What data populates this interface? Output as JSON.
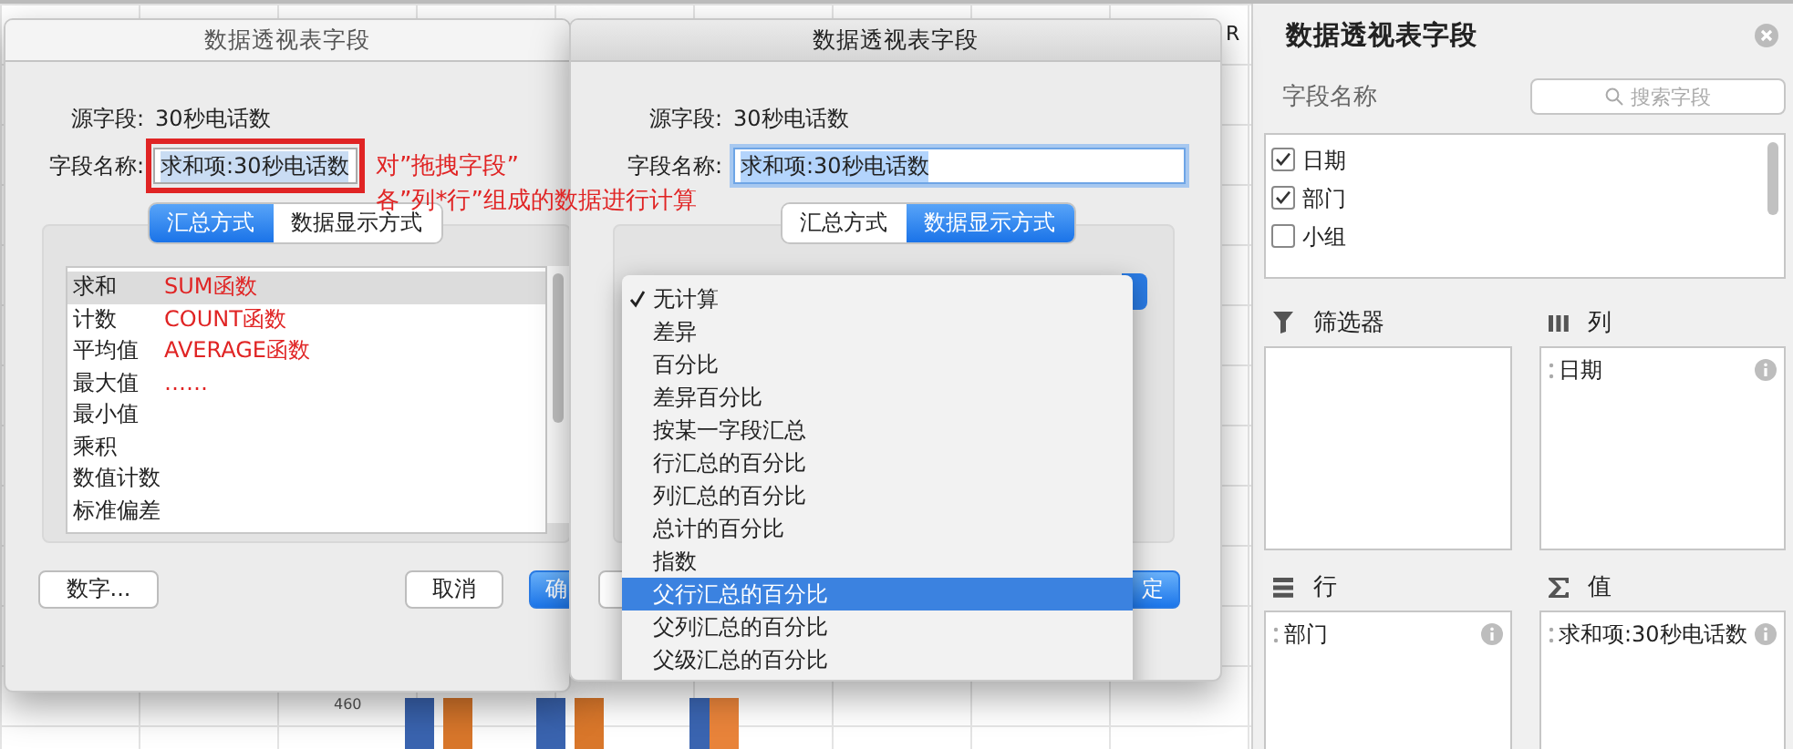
{
  "sheet": {
    "column_header": "R",
    "axis_label": "460"
  },
  "dialogs": [
    {
      "title": "数据透视表字段",
      "focused": false,
      "source_label": "源字段:",
      "source_value": "30秒电话数",
      "name_label": "字段名称:",
      "name_value": "求和项:30秒电话数",
      "tabs": [
        {
          "label": "汇总方式",
          "selected": true
        },
        {
          "label": "数据显示方式",
          "selected": false
        }
      ],
      "list": [
        {
          "label": "求和",
          "note": "SUM函数",
          "selected": true
        },
        {
          "label": "计数",
          "note": "COUNT函数",
          "selected": false
        },
        {
          "label": "平均值",
          "note": "AVERAGE函数",
          "selected": false
        },
        {
          "label": "最大值",
          "note": "……",
          "selected": false
        },
        {
          "label": "最小值",
          "selected": false
        },
        {
          "label": "乘积",
          "selected": false
        },
        {
          "label": "数值计数",
          "selected": false
        },
        {
          "label": "标准偏差",
          "selected": false
        }
      ],
      "buttons": [
        {
          "label": "数字...",
          "kind": "normal"
        },
        {
          "label": "取消",
          "kind": "normal"
        },
        {
          "label": "确",
          "kind": "default"
        }
      ]
    },
    {
      "title": "数据透视表字段",
      "focused": true,
      "source_label": "源字段:",
      "source_value": "30秒电话数",
      "name_label": "字段名称:",
      "name_value": "求和项:30秒电话数",
      "tabs": [
        {
          "label": "汇总方式",
          "selected": false
        },
        {
          "label": "数据显示方式",
          "selected": true
        }
      ],
      "menu": [
        {
          "label": "无计算",
          "checked": true,
          "selected": false
        },
        {
          "label": "差异",
          "checked": false,
          "selected": false
        },
        {
          "label": "百分比",
          "checked": false,
          "selected": false
        },
        {
          "label": "差异百分比",
          "checked": false,
          "selected": false
        },
        {
          "label": "按某一字段汇总",
          "checked": false,
          "selected": false
        },
        {
          "label": "行汇总的百分比",
          "checked": false,
          "selected": false
        },
        {
          "label": "列汇总的百分比",
          "checked": false,
          "selected": false
        },
        {
          "label": "总计的百分比",
          "checked": false,
          "selected": false
        },
        {
          "label": "指数",
          "checked": false,
          "selected": false
        },
        {
          "label": "父行汇总的百分比",
          "checked": false,
          "selected": true
        },
        {
          "label": "父列汇总的百分比",
          "checked": false,
          "selected": false
        },
        {
          "label": "父级汇总的百分比",
          "checked": false,
          "selected": false
        }
      ],
      "buttons": [
        {
          "label": "定",
          "kind": "default"
        }
      ]
    }
  ],
  "annotation": {
    "lines": [
      "对”拖拽字段”",
      "各”列*行”组成的数据进行计算"
    ]
  },
  "panel": {
    "title": "数据透视表字段",
    "fields_label": "字段名称",
    "search": {
      "placeholder": "搜索字段"
    },
    "fields": [
      {
        "label": "日期",
        "checked": true
      },
      {
        "label": "部门",
        "checked": true
      },
      {
        "label": "小组",
        "checked": false
      }
    ],
    "areas": [
      {
        "kind": "filter",
        "label": "筛选器"
      },
      {
        "kind": "columns",
        "label": "列",
        "items": [
          "日期"
        ]
      },
      {
        "kind": "rows",
        "label": "行",
        "items": [
          "部门"
        ]
      },
      {
        "kind": "values",
        "label": "值",
        "items": [
          "求和项:30秒电话数"
        ]
      }
    ]
  }
}
